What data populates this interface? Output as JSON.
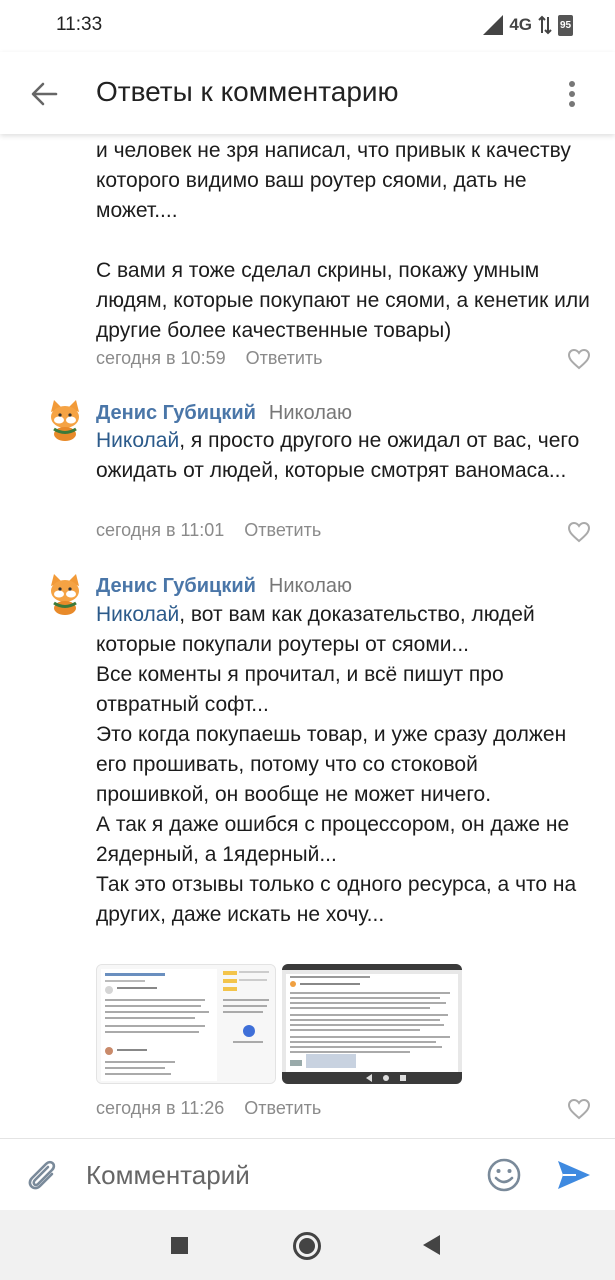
{
  "status_bar": {
    "time": "11:33",
    "network": "4G",
    "battery": "95"
  },
  "header": {
    "title": "Ответы к комментарию"
  },
  "comments": [
    {
      "text": "и человек не зря написал, что привык к качеству которого видимо ваш роутер сяоми, дать не может....\n\nС вами я тоже сделал скрины, покажу умным людям, которые покупают не сяоми, а кенетик или другие более качественные товары)",
      "time": "сегодня в 10:59",
      "reply_label": "Ответить"
    },
    {
      "author": "Денис Губицкий",
      "addressee": "Николаю",
      "mention": "Николай",
      "text": ", я просто другого не ожидал от вас, чего ожидать от людей, которые смотрят ваномаса...",
      "time": "сегодня в 11:01",
      "reply_label": "Ответить"
    },
    {
      "author": "Денис Губицкий",
      "addressee": "Николаю",
      "mention": "Николай",
      "text": ", вот вам как доказательство, людей которые покупали роутеры от сяоми...\nВсе коменты я прочитал, и всё пишут про отвратный софт...\nЭто когда покупаешь товар, и уже сразу должен его прошивать, потому что со стоковой прошивкой, он вообще не может ничего.\nА так я даже ошибся с процессором, он даже не 2ядерный, а 1ядерный...\nТак это отзывы только с одного ресурса, а что на других, даже искать не хочу...",
      "time": "сегодня в 11:26",
      "reply_label": "Ответить"
    }
  ],
  "composer": {
    "placeholder": "Комментарий"
  },
  "icons": {
    "back": "arrow-back-icon",
    "menu": "more-vertical-icon",
    "like": "heart-outline-icon",
    "attach": "paperclip-icon",
    "emoji": "smile-icon",
    "send": "send-icon"
  },
  "colors": {
    "author": "#4a76a8",
    "send": "#3f8ae0",
    "meta": "#8a8a8a"
  }
}
